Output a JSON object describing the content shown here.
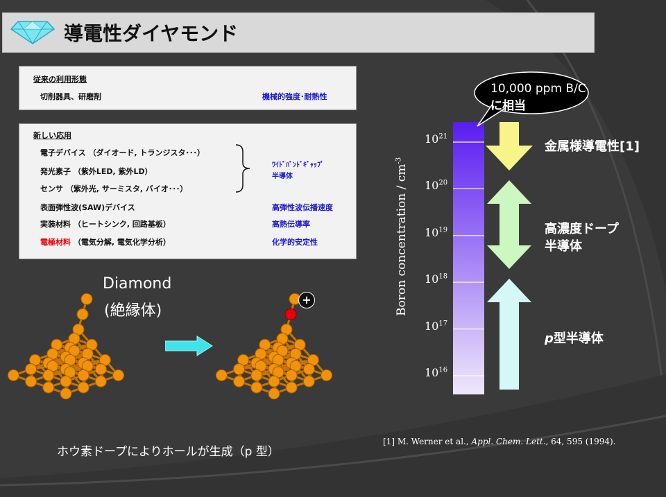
{
  "title": "導電性ダイヤモンド",
  "box1": {
    "heading": "従来の利用形態",
    "left": "切削器具、研磨剤",
    "right": "機械的強度･耐熱性"
  },
  "box2": {
    "heading": "新しい応用",
    "items": [
      {
        "left": "電子デバイス （ダイオード, トランジスタ･･･）",
        "right": ""
      },
      {
        "left": "発光素子 （紫外LED, 紫外LD）",
        "right": ""
      },
      {
        "left": "センサ （紫外光, サーミスタ, バイオ･･･）",
        "right": ""
      },
      {
        "left": "表面弾性波(SAW)デバイス",
        "right": "高弾性波伝播速度"
      },
      {
        "left": "実装材料 （ヒートシンク, 回路基板）",
        "right": "高熱伝導率"
      },
      {
        "left_red": "電極材料",
        "left": " （電気分解, 電気化学分析）",
        "right": "化学的安定性"
      }
    ],
    "bracket_label_1": "ﾜｲﾄﾞﾊﾞﾝﾄﾞｷﾞｬｯﾌﾟ",
    "bracket_label_2": "半導体"
  },
  "diamond_label_1": "Diamond",
  "diamond_label_2": "(絶縁体)",
  "hole_symbol": "+",
  "caption": "ホウ素ドープによりホールが生成（p 型）",
  "callout_line1": "10,000 ppm B/C",
  "callout_line2": "に相当",
  "axis_label": "Boron concentration / cm",
  "axis_label_exp": "-3",
  "ticks": [
    {
      "base": "10",
      "exp": "21",
      "value": 21
    },
    {
      "base": "10",
      "exp": "20",
      "value": 20
    },
    {
      "base": "10",
      "exp": "19",
      "value": 19
    },
    {
      "base": "10",
      "exp": "18",
      "value": 18
    },
    {
      "base": "10",
      "exp": "17",
      "value": 17
    },
    {
      "base": "10",
      "exp": "16",
      "value": 16
    }
  ],
  "regions": [
    {
      "label": "金属様導電性[1]"
    },
    {
      "label_1": "高濃度ドープ",
      "label_2": "半導体"
    },
    {
      "label_italic": "p",
      "label": "型半導体"
    }
  ],
  "reference": {
    "prefix": "[1] M. Werner et al., ",
    "journal": "Appl. Chem. Lett.",
    "suffix": ", 64, 595 (1994)."
  },
  "colors": {
    "bar_top": "#5a1cf0",
    "bar_bottom": "#efe8fb",
    "arrow_yellow": "#f7f58a",
    "arrow_green": "#cdf7c0",
    "arrow_cyan": "#d4f8f6",
    "atom": "#f0920c",
    "dopant": "#e8000b"
  }
}
